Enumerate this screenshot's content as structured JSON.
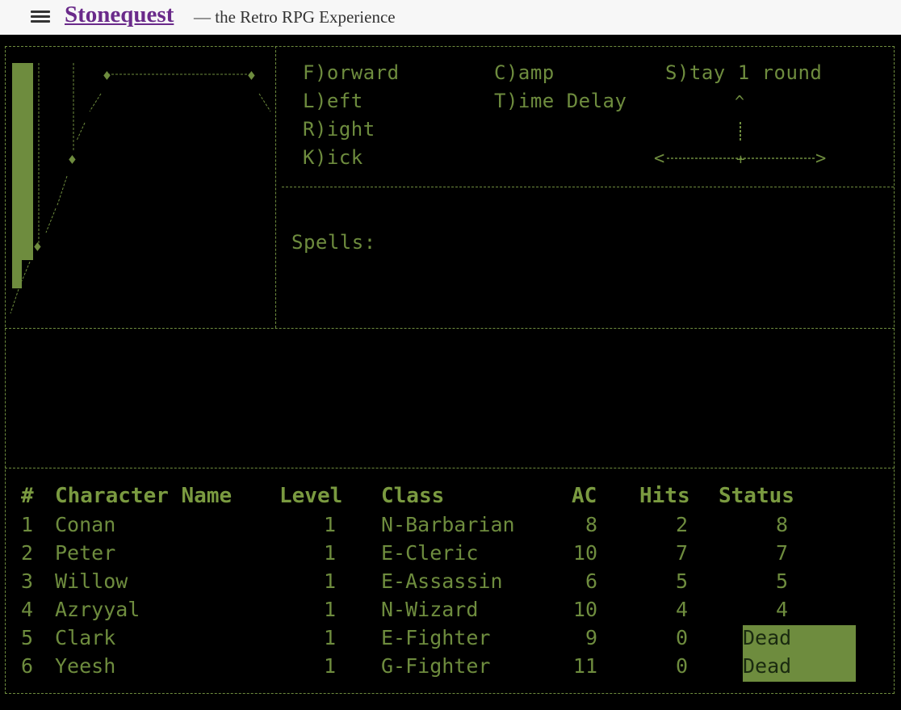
{
  "header": {
    "brand": "Stonequest",
    "tagline": "— the Retro RPG Experience"
  },
  "commands": {
    "forward": "F)orward",
    "left": "L)eft",
    "right": "R)ight",
    "kick": "K)ick",
    "camp": "C)amp",
    "time_delay": "T)ime Delay",
    "stay": "S)tay 1 round"
  },
  "spells_label": "Spells:",
  "party": {
    "columns": [
      "#",
      "Character Name",
      "Level",
      "Class",
      "AC",
      "Hits",
      "Status"
    ],
    "rows": [
      {
        "num": "1",
        "name": "Conan",
        "level": "1",
        "class": "N-Barbarian",
        "ac": "8",
        "hits": "2",
        "status": "8"
      },
      {
        "num": "2",
        "name": "Peter",
        "level": "1",
        "class": "E-Cleric",
        "ac": "10",
        "hits": "7",
        "status": "7"
      },
      {
        "num": "3",
        "name": "Willow",
        "level": "1",
        "class": "E-Assassin",
        "ac": "6",
        "hits": "5",
        "status": "5"
      },
      {
        "num": "4",
        "name": "Azryyal",
        "level": "1",
        "class": "N-Wizard",
        "ac": "10",
        "hits": "4",
        "status": "4"
      },
      {
        "num": "5",
        "name": "Clark",
        "level": "1",
        "class": "E-Fighter",
        "ac": "9",
        "hits": "0",
        "status": "Dead"
      },
      {
        "num": "6",
        "name": "Yeesh",
        "level": "1",
        "class": "G-Fighter",
        "ac": "11",
        "hits": "0",
        "status": "Dead"
      }
    ]
  },
  "colors": {
    "terminal_green": "#6e8c3e",
    "background": "#000000",
    "brand_purple": "#6a2a8a"
  },
  "icons": {
    "menu": "hamburger-icon",
    "compass": "direction-cross-icon"
  }
}
